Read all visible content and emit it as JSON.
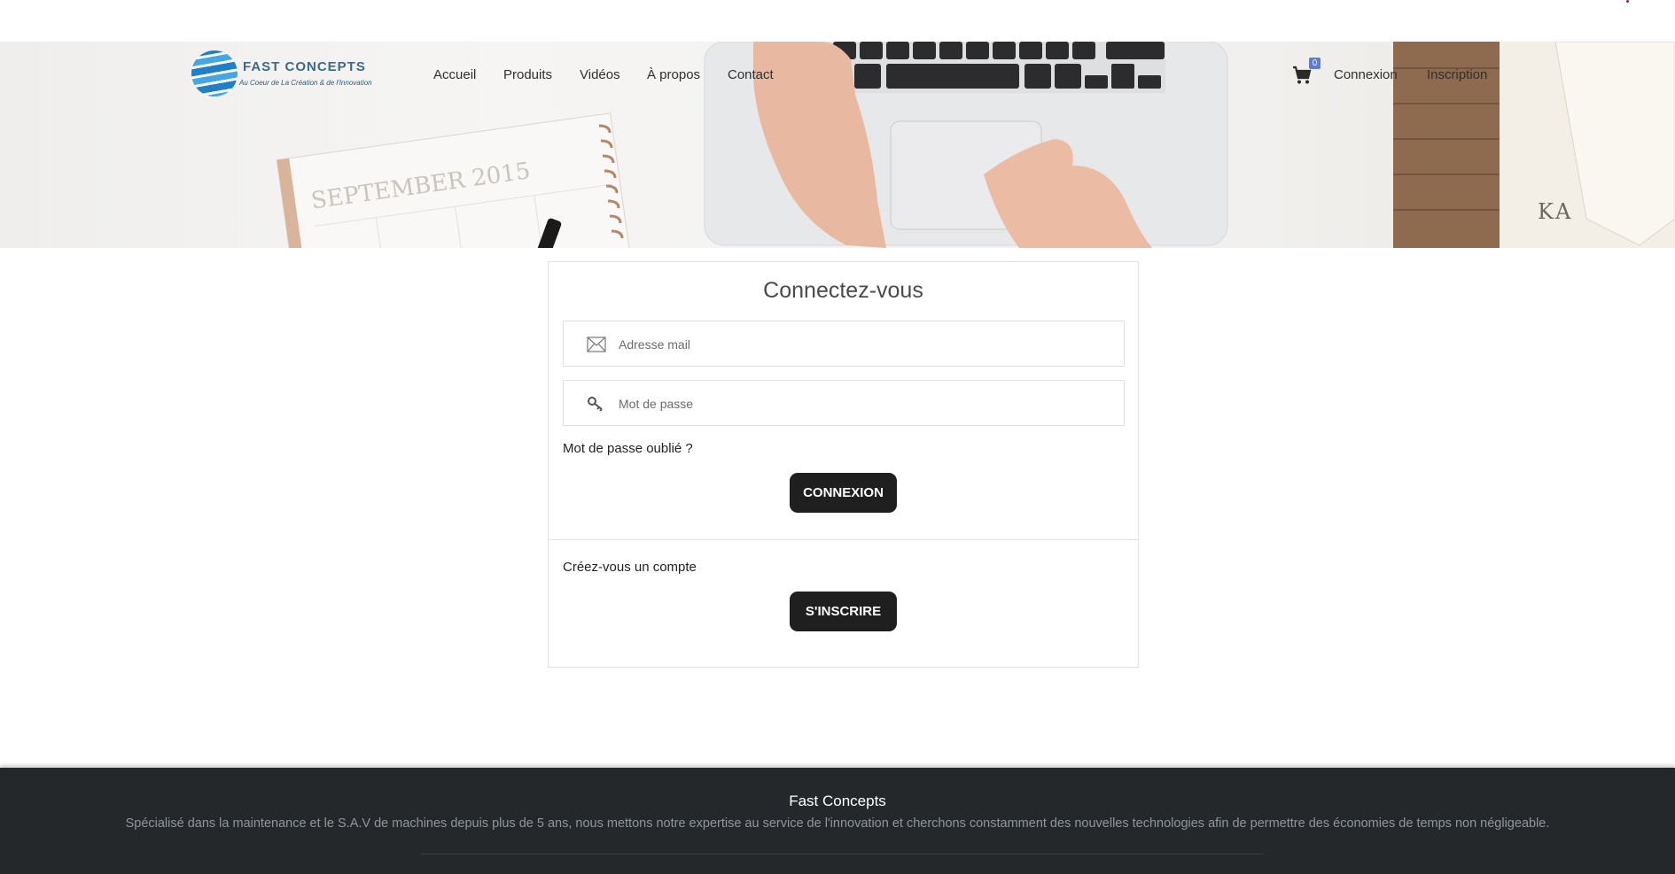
{
  "header": {
    "brand": "FAST CONCEPTS",
    "tagline": "Au Coeur de La Création & de l'Innovation",
    "hero_calendar_text": "SEPTEMBER 2015",
    "hero_book_text": "KA",
    "nav": [
      "Accueil",
      "Produits",
      "Vidéos",
      "À propos",
      "Contact"
    ],
    "cart_count": "0",
    "login_link": "Connexion",
    "signup_link": "Inscription"
  },
  "login": {
    "title": "Connectez-vous",
    "email_placeholder": "Adresse mail",
    "password_placeholder": "Mot de passe",
    "forgot": "Mot de passe oublié ?",
    "submit": "CONNEXION",
    "create_text": "Créez-vous un compte",
    "signup_button": "S'INSCRIRE"
  },
  "footer": {
    "title": "Fast Concepts",
    "description": "Spécialisé dans la maintenance et le S.A.V de machines depuis plus de 5 ans, nous mettons notre expertise au service de l'innovation et cherchons constamment des nouvelles technologies afin de permettre des économies de temps non négligeable."
  },
  "icons": {
    "email": "envelope-icon",
    "password": "key-icon",
    "cart": "cart-icon"
  },
  "colors": {
    "button": "#1f1f1f",
    "footer_bg": "#25282b",
    "cart_badge": "#5a7bd6"
  }
}
